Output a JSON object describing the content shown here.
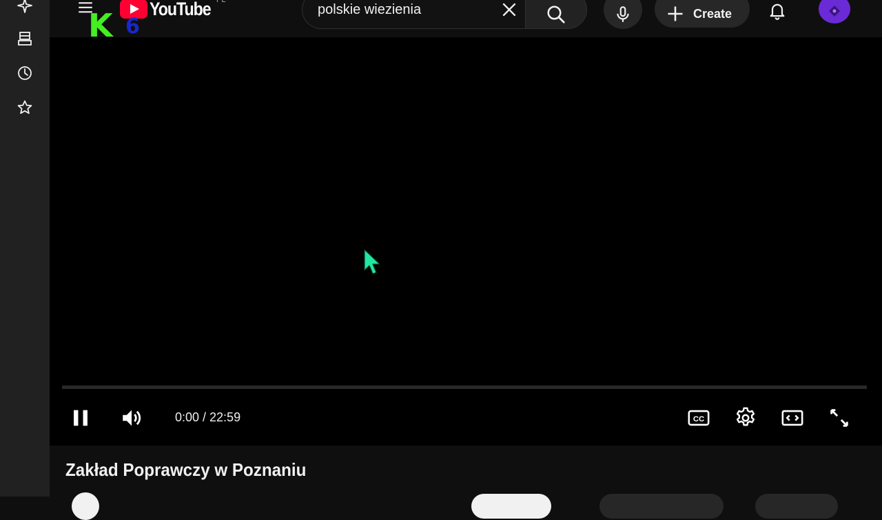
{
  "app": {
    "logo_text": "YouTube",
    "country_code": "PL",
    "watermark": {
      "letter": "K",
      "digit": "6"
    }
  },
  "rail": {
    "items": [
      {
        "name": "sparkle-icon"
      },
      {
        "name": "subscriptions-icon"
      },
      {
        "name": "history-icon"
      },
      {
        "name": "star-icon"
      }
    ]
  },
  "search": {
    "query": "polskie wiezienia"
  },
  "header": {
    "create_label": "Create"
  },
  "player": {
    "time_readout": "0:00 / 22:59",
    "progress_fraction": 0.0,
    "state": "playing"
  },
  "video": {
    "title": "Zakład Poprawczy w Poznaniu"
  },
  "colors": {
    "accent": "#ff0033",
    "background": "#0f0f0f",
    "avatar": "#6a2bd6",
    "cursor": "#22e6a0"
  }
}
